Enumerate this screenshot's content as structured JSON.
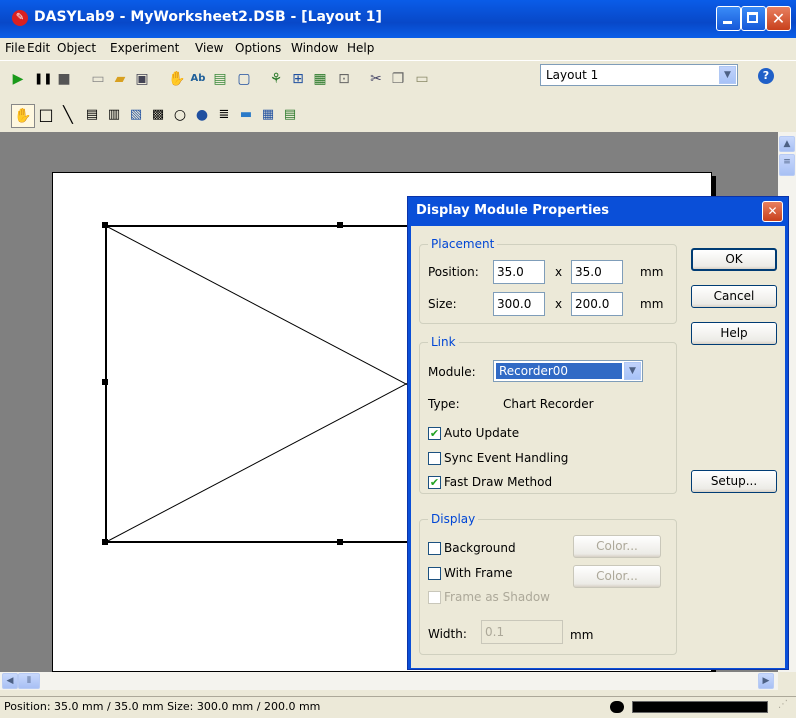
{
  "window": {
    "title": "DASYLab9 - MyWorksheet2.DSB - [Layout 1]"
  },
  "menu": [
    "File",
    "Edit",
    "Object",
    "Experiment",
    "View",
    "Options",
    "Window",
    "Help"
  ],
  "toolbar": {
    "layout_value": "Layout 1"
  },
  "status": {
    "text": "Position: 35.0 mm / 35.0 mm   Size: 300.0 mm / 200.0 mm"
  },
  "dialog": {
    "title": "Display Module Properties",
    "placement": {
      "legend": "Placement",
      "position_label": "Position:",
      "size_label": "Size:",
      "pos_x": "35.0",
      "pos_y": "35.0",
      "size_x": "300.0",
      "size_y": "200.0",
      "times": "x",
      "unit": "mm"
    },
    "link": {
      "legend": "Link",
      "module_label": "Module:",
      "module_value": "Recorder00",
      "type_label": "Type:",
      "type_value": "Chart Recorder",
      "auto_update": "Auto Update",
      "sync_event": "Sync Event Handling",
      "fast_draw": "Fast Draw Method"
    },
    "display": {
      "legend": "Display",
      "background": "Background",
      "with_frame": "With Frame",
      "frame_shadow": "Frame as Shadow",
      "color_button": "Color...",
      "width_label": "Width:",
      "width_value": "0.1",
      "width_unit": "mm"
    },
    "buttons": {
      "ok": "OK",
      "cancel": "Cancel",
      "help": "Help",
      "setup": "Setup..."
    }
  }
}
